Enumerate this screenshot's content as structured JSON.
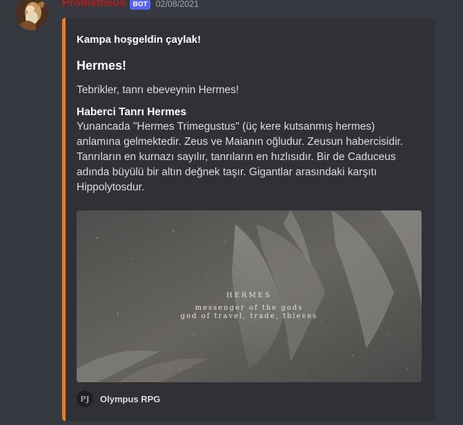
{
  "message": {
    "username": "Prometheus",
    "bot_badge": "BOT",
    "timestamp": "02/08/2021",
    "avatar_icon": "bearded-figure-avatar",
    "colors": {
      "username": "#b51d1d",
      "badge": "#5865f2",
      "embed_accent": "#e67e22"
    }
  },
  "embed": {
    "author": "Kampa hoşgeldin çaylak!",
    "title": "Hermes!",
    "description": "Tebrikler, tanrı ebeveynin Hermes!",
    "field": {
      "name": "Haberci Tanrı Hermes",
      "value_lines": [
        "Yunancada \"Hermes Trimegustus\" (üç kere kutsanmış hermes)",
        "anlamına gelmektedir. Zeus ve Maianın oğludur. Zeusun habercisidir.",
        "Tanrıların en kurnazı sayılır, tanrıların en hızlısıdır. Bir de Caduceus",
        "adında büyülü bir altın değnek taşır. Gigantlar arasındaki karşıtı",
        "Hippolytosdur."
      ]
    },
    "image": {
      "title": "HERMES",
      "line1": "messenger of the gods",
      "line2": "god of travel, trade, thieves"
    },
    "footer": {
      "icon_text": "PJ",
      "text": "Olympus RPG"
    }
  }
}
